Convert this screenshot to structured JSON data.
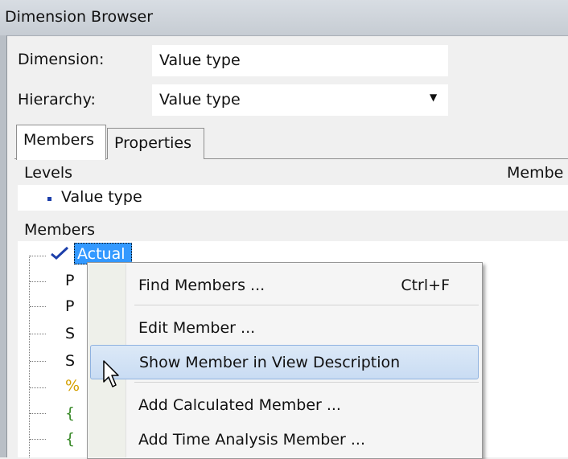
{
  "window": {
    "title": "Dimension Browser"
  },
  "form": {
    "dimension_label": "Dimension:",
    "dimension_value": "Value type",
    "hierarchy_label": "Hierarchy:",
    "hierarchy_value": "Value type"
  },
  "tabs": [
    {
      "label": "Members",
      "selected": true
    },
    {
      "label": "Properties",
      "selected": false
    }
  ],
  "levels": {
    "header": "Levels",
    "member_col_header": "Membe",
    "items": [
      "Value type"
    ]
  },
  "members": {
    "header": "Members",
    "selected_item": "Actual",
    "partial_items": [
      "P",
      "P",
      "S",
      "S",
      "%",
      "{",
      "{"
    ]
  },
  "context_menu": {
    "items": [
      {
        "label": "Find Members ...",
        "shortcut": "Ctrl+F"
      },
      {
        "label": "Edit Member ..."
      },
      {
        "label": "Show Member in View Description",
        "highlighted": true
      },
      {
        "label": "Add Calculated Member ..."
      },
      {
        "label": "Add Time Analysis Member ..."
      }
    ]
  },
  "colors": {
    "selection": "#3399ff",
    "menu_highlight": "#c9dcf3",
    "check": "#1d3faa"
  }
}
